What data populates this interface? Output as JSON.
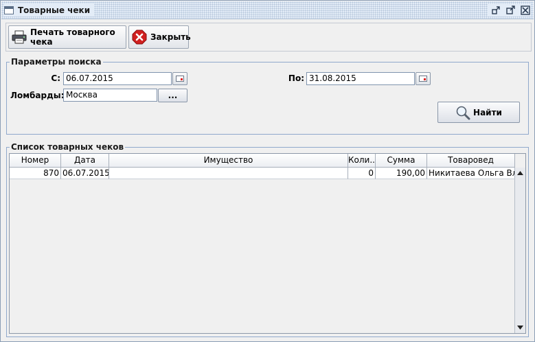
{
  "window": {
    "title": "Товарные чеки"
  },
  "toolbar": {
    "print_label": "Печать товарного чека",
    "close_label": "Закрыть"
  },
  "search": {
    "legend": "Параметры поиска",
    "from_label": "С:",
    "from_value": "06.07.2015",
    "to_label": "По:",
    "to_value": "31.08.2015",
    "pawnshops_label": "Ломбарды:",
    "pawnshops_value": "Москва",
    "browse_label": "...",
    "find_label": "Найти"
  },
  "list": {
    "legend": "Список товарных чеков",
    "columns": [
      "Номер",
      "Дата",
      "Имущество",
      "Коли...",
      "Сумма",
      "Товаровед"
    ],
    "rows": [
      {
        "number": "870",
        "date": "06.07.2015",
        "property": "",
        "qty": "0",
        "sum": "190,00",
        "merchandiser": "Никитаева Ольга Вл..."
      }
    ]
  },
  "colors": {
    "accent_border": "#8fa8cc",
    "close_icon": "#d02020"
  },
  "icons": [
    "window-icon",
    "restore-icon",
    "maximize-icon",
    "close-window-icon",
    "printer-icon",
    "close-circle-icon",
    "calendar-icon",
    "magnifier-icon",
    "scroll-up-icon",
    "scroll-down-icon"
  ]
}
